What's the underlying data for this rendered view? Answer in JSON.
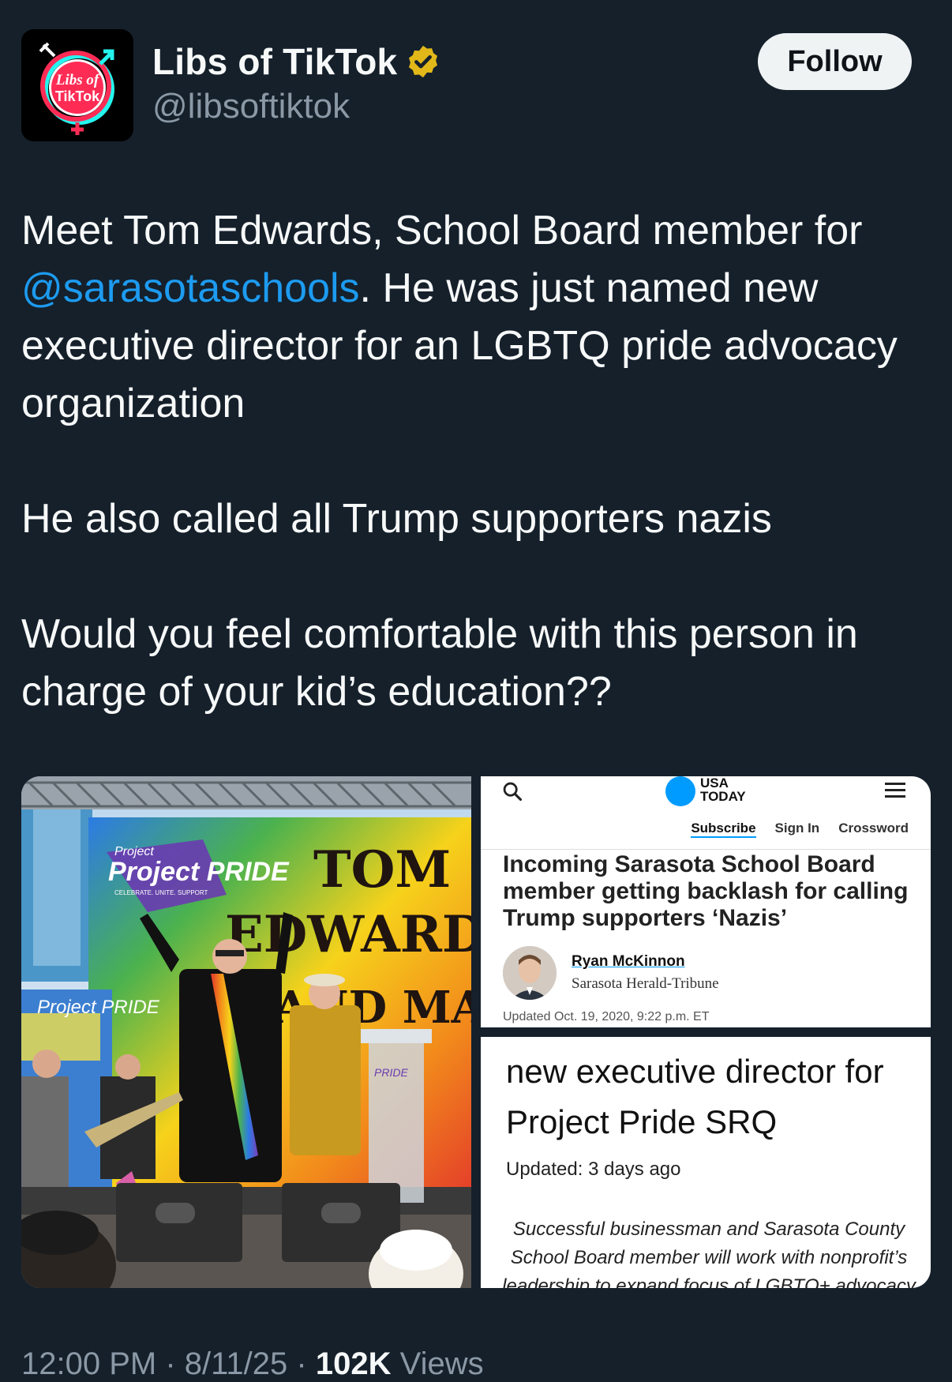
{
  "account": {
    "avatar_text_line1": "Libs of",
    "avatar_text_line2": "TikTok",
    "display_name": "Libs of TikTok",
    "handle": "@libsoftiktok",
    "verified_badge": "gold-verified-badge-icon"
  },
  "follow_label": "Follow",
  "tweet": {
    "line1": "Meet Tom Edwards, School Board member for",
    "mention": "@sarasotaschools",
    "line2_rest": ". He was just named new executive director for an LGBTQ pride advocacy organization",
    "para2": "He also called all Trump supporters nazis",
    "para3": "Would you feel comfortable with this person in charge of your kid’s education??"
  },
  "media": {
    "photo": {
      "banner_logo": "Project PRIDE",
      "banner_tagline": "CELEBRATE. UNITE. SUPPORT",
      "banner_name1": "TOM",
      "banner_name2": "EDWARDS",
      "banner_name3": "AND MARS",
      "side_banner": "Project PRIDE",
      "podium_logo": "PRIDE"
    },
    "article1": {
      "logo_line1": "USA",
      "logo_line2": "TODAY",
      "nav": [
        "Subscribe",
        "Sign In",
        "Crossword"
      ],
      "headline": "Incoming Sarasota School Board member getting backlash for calling Trump supporters ‘Nazis’",
      "author": "Ryan McKinnon",
      "publication": "Sarasota Herald-Tribune",
      "updated": "Updated Oct. 19, 2020, 9:22 p.m. ET"
    },
    "article2": {
      "headline": "new executive director for Project Pride SRQ",
      "updated": "Updated: 3 days ago",
      "summary": "Successful businessman and Sarasota County School Board member will work with nonprofit’s leadership to expand focus of LGBTQ+ advocacy"
    }
  },
  "meta": {
    "time": "12:00 PM",
    "separator": "·",
    "date": "8/11/25",
    "views_count": "102K",
    "views_label": "Views"
  },
  "colors": {
    "background": "#15202b",
    "link": "#1d9bf0",
    "secondary_text": "#8b98a5"
  }
}
